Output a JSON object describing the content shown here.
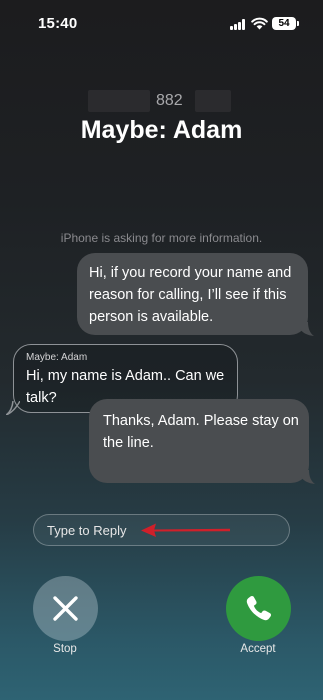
{
  "status_bar": {
    "time": "15:40",
    "battery": "54"
  },
  "call": {
    "number": "882",
    "name": "Maybe: Adam"
  },
  "notice": "iPhone is asking for more information.",
  "messages": [
    {
      "type": "outgoing",
      "text": "Hi, if you record your name and reason for calling, I’ll see if this person is available."
    },
    {
      "type": "incoming",
      "sender": "Maybe: Adam",
      "text": "Hi, my name is Adam..  Can we talk?"
    },
    {
      "type": "outgoing",
      "text": "Thanks, Adam. Please stay on the line."
    }
  ],
  "reply": {
    "placeholder": "Type to Reply"
  },
  "actions": {
    "stop_label": "Stop",
    "accept_label": "Accept"
  },
  "colors": {
    "accept": "#2f9a3f",
    "annotation_arrow": "#d0202a",
    "outgoing_bubble": "#4a4d50"
  },
  "icons": {
    "signal": "cellular-signal-icon",
    "wifi": "wifi-icon",
    "battery": "battery-icon",
    "stop": "close-x-icon",
    "accept": "phone-icon",
    "annotation": "red-arrow-icon"
  }
}
